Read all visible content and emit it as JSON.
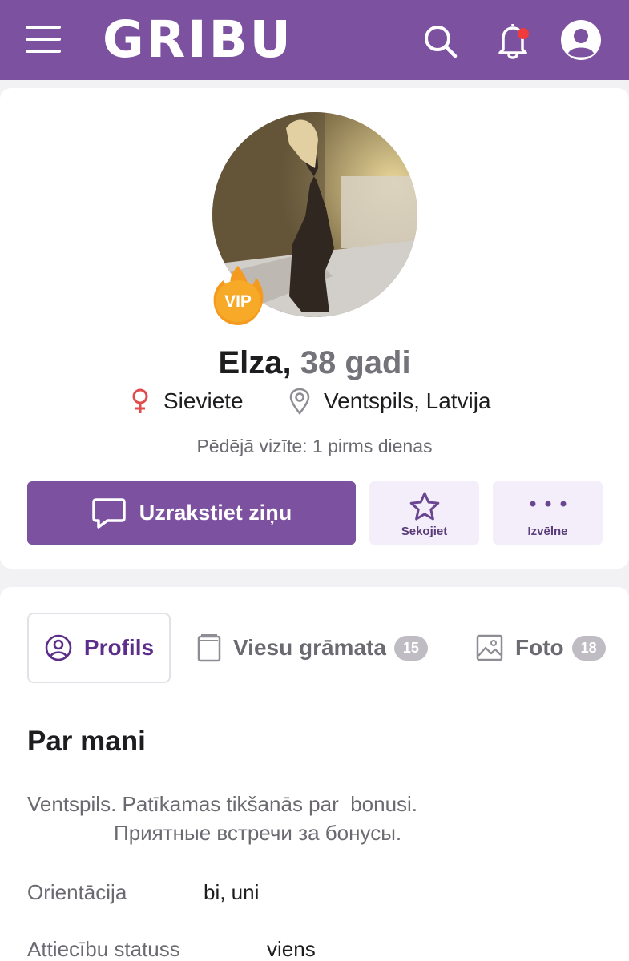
{
  "header": {
    "logo": "GRIBU",
    "icons": [
      "menu-icon",
      "search-icon",
      "bell-icon",
      "account-icon"
    ],
    "notification_dot_color": "#ef3b3b",
    "bar_color": "#7c51a0"
  },
  "profile": {
    "name": "Elza,",
    "age": "38 gadi",
    "vip_label": "VIP",
    "gender": "Sieviete",
    "location": "Ventspils, Latvija",
    "last_visit": "Pēdējā vizīte: 1 pirms dienas"
  },
  "actions": {
    "message": "Uzrakstiet ziņu",
    "follow": "Sekojiet",
    "menu": "Izvēlne"
  },
  "tabs": [
    {
      "label": "Profils",
      "active": true
    },
    {
      "label": "Viesu grāmata",
      "count": "15"
    },
    {
      "label": "Foto",
      "count": "18"
    }
  ],
  "about": {
    "title": "Par mani",
    "line1": "Ventspils. Patīkamas tikšanās par  bonusi.",
    "line2": "Приятные встречи за бонусы.",
    "fields": [
      {
        "label": "Orientācija",
        "value": "bi, uni"
      },
      {
        "label": "Attiecību statuss",
        "value": "viens"
      }
    ]
  }
}
